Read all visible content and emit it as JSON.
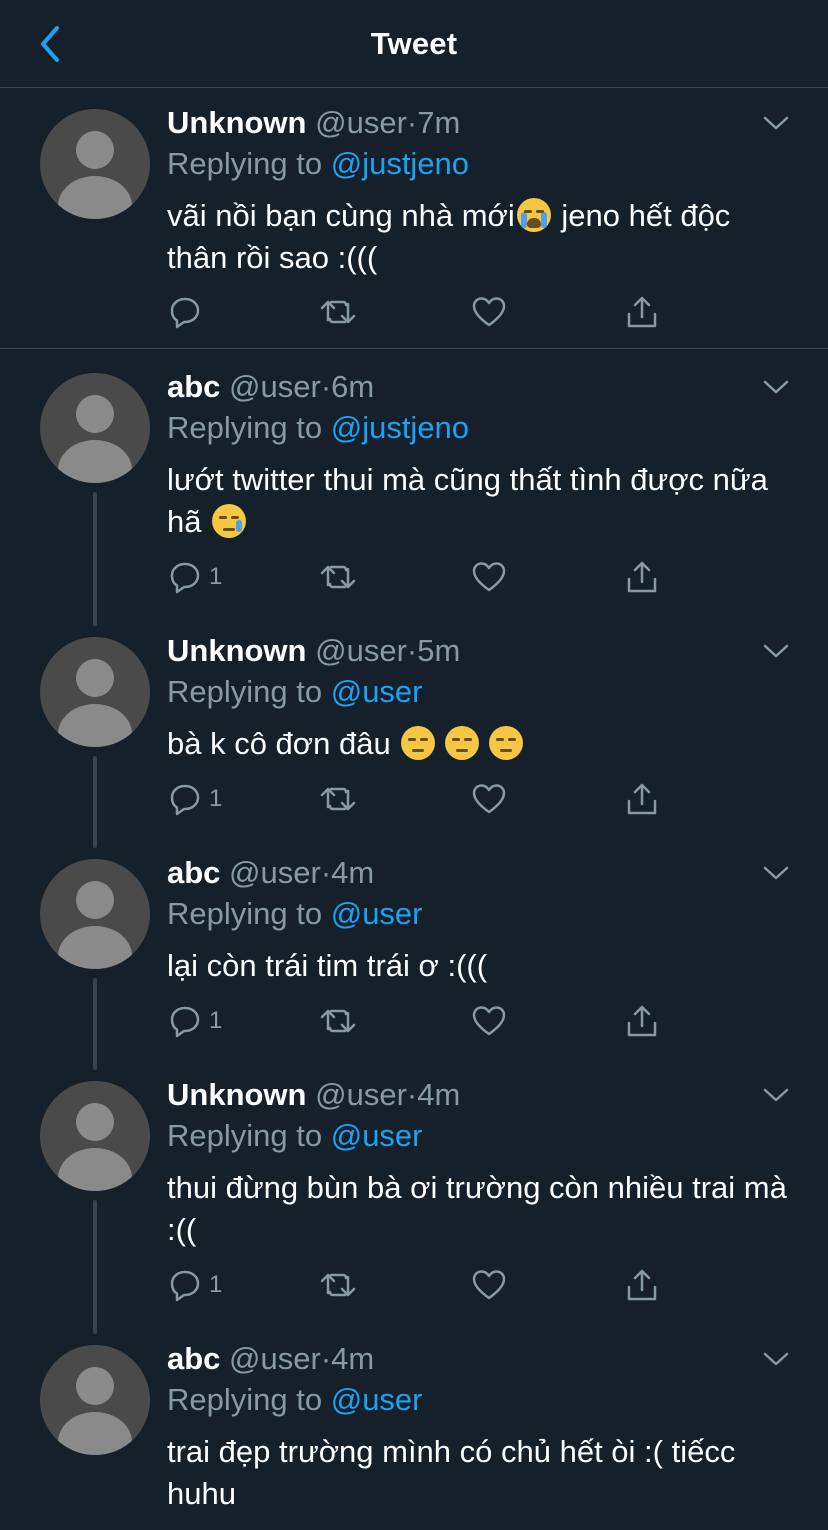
{
  "header": {
    "title": "Tweet"
  },
  "tweets": [
    {
      "name": "Unknown",
      "handle": "@user",
      "dot": "·",
      "time": "7m",
      "replying_prefix": "Replying to ",
      "replying_to": "@justjeno",
      "text_a": "vãi nồi bạn cùng nhà mới",
      "emoji_a": "loudly-crying-face",
      "text_b": " jeno hết độc thân rồi sao :(((",
      "reply_count": ""
    },
    {
      "name": "abc",
      "handle": "@user",
      "dot": "·",
      "time": "6m",
      "replying_prefix": "Replying to ",
      "replying_to": "@justjeno",
      "text_a": "lướt twitter thui mà cũng thất tình được nữa hã ",
      "emoji_a": "face-holding-back-tears",
      "reply_count": "1"
    },
    {
      "name": "Unknown",
      "handle": "@user",
      "dot": "·",
      "time": "5m",
      "replying_prefix": "Replying to ",
      "replying_to": "@user",
      "text_a": "bà k cô đơn đâu ",
      "emoji_a": "pensive-face",
      "emoji_b": "pensive-face",
      "emoji_c": "pensive-face",
      "reply_count": "1"
    },
    {
      "name": "abc",
      "handle": "@user",
      "dot": "·",
      "time": "4m",
      "replying_prefix": "Replying to ",
      "replying_to": "@user",
      "text_a": "lại còn trái tim trái ơ :(((",
      "reply_count": "1"
    },
    {
      "name": "Unknown",
      "handle": "@user",
      "dot": "·",
      "time": "4m",
      "replying_prefix": "Replying to ",
      "replying_to": "@user",
      "text_a": "thui đừng bùn bà ơi trường còn nhiều trai mà :((",
      "reply_count": "1"
    },
    {
      "name": "abc",
      "handle": "@user",
      "dot": "·",
      "time": "4m",
      "replying_prefix": "Replying to ",
      "replying_to": "@user",
      "text_a": "trai đẹp trường mình có chủ hết òi :( tiếcc huhu"
    }
  ],
  "colors": {
    "background": "#15202b",
    "divider": "#38444d",
    "secondary_text": "#8899a6",
    "accent": "#1da1f2"
  }
}
